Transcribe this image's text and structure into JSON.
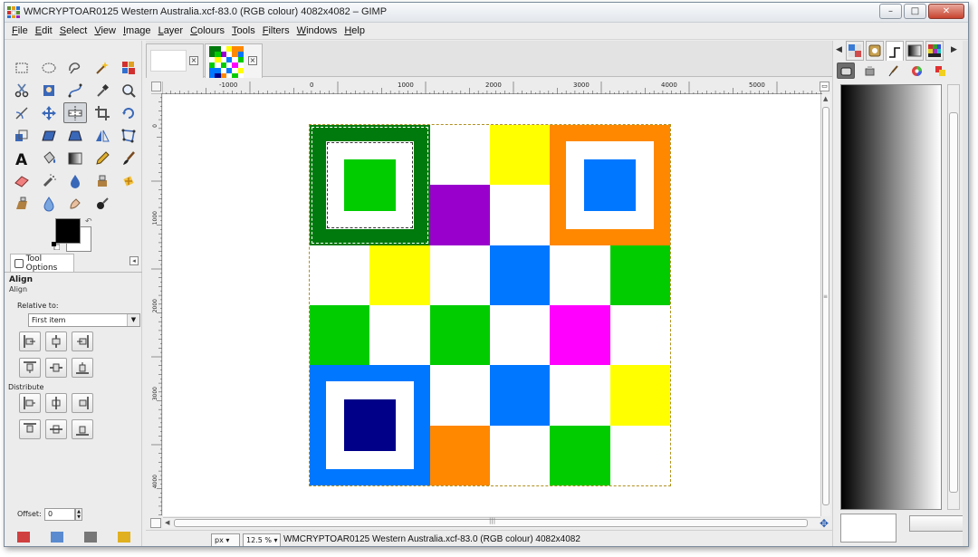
{
  "window": {
    "title": "WMCRYPTOAR0125 Western Australia.xcf-83.0 (RGB colour) 4082x4082 – GIMP",
    "minimize": "–",
    "maximize": "□",
    "close": "✕"
  },
  "menu": [
    "File",
    "Edit",
    "Select",
    "View",
    "Image",
    "Layer",
    "Colours",
    "Tools",
    "Filters",
    "Windows",
    "Help"
  ],
  "toolbox": {
    "tools": [
      "rect-select-icon",
      "ellipse-select-icon",
      "free-select-icon",
      "fuzzy-select-icon",
      "select-by-color-icon",
      "scissors-icon",
      "foreground-select-icon",
      "paths-icon",
      "color-picker-icon",
      "zoom-icon",
      "measure-icon",
      "move-icon",
      "align-icon",
      "crop-icon",
      "rotate-icon",
      "scale-icon",
      "shear-icon",
      "perspective-icon",
      "flip-icon",
      "cage-icon",
      "text-icon",
      "bucket-fill-icon",
      "blend-icon",
      "pencil-icon",
      "paintbrush-icon",
      "eraser-icon",
      "airbrush-icon",
      "ink-icon",
      "clone-icon",
      "heal-icon",
      "perspective-clone-icon",
      "blur-icon",
      "smudge-icon",
      "dodge-burn-icon"
    ],
    "active_tool": "align-icon",
    "foreground_color": "#000000",
    "background_color": "#ffffff"
  },
  "tool_options": {
    "tab_label": "Tool Options",
    "title": "Align",
    "subtitle": "Align",
    "relative_to_label": "Relative to:",
    "relative_to_value": "First item",
    "distribute_label": "Distribute",
    "offset_label": "Offset:",
    "offset_value": "0"
  },
  "rulers": {
    "h_labels": [
      "-1000",
      "0",
      "1000",
      "2000",
      "3000",
      "4000",
      "5000"
    ],
    "v_labels": [
      "0",
      "1000",
      "2000",
      "3000",
      "4000"
    ]
  },
  "image": {
    "colors": {
      "dark_green": "#007a0c",
      "green": "#00cc00",
      "white": "#ffffff",
      "yellow": "#ffff00",
      "purple": "#9900cc",
      "orange": "#ff8800",
      "blue": "#0077ff",
      "magenta": "#ff00ff",
      "navy": "#000088"
    },
    "grid": [
      [
        "F",
        "F",
        "white",
        "yellow",
        "F",
        "F"
      ],
      [
        "F",
        "F",
        "purple",
        "white",
        "F",
        "F"
      ],
      [
        "white",
        "yellow",
        "white",
        "blue",
        "white",
        "green"
      ],
      [
        "green",
        "white",
        "green",
        "white",
        "magenta",
        "white"
      ],
      [
        "F",
        "F",
        "white",
        "blue",
        "white",
        "yellow"
      ],
      [
        "F",
        "F",
        "orange",
        "white",
        "green",
        "white"
      ]
    ],
    "finders": [
      {
        "name": "finder-top-left",
        "outer": "dark_green",
        "inner": "green"
      },
      {
        "name": "finder-top-right",
        "outer": "orange",
        "inner": "blue"
      },
      {
        "name": "finder-bottom-left",
        "outer": "blue",
        "inner": "navy"
      }
    ]
  },
  "statusbar": {
    "unit": "px",
    "zoom": "12.5 %",
    "text": "WMCRYPTOAR0125 Western Australia.xcf-83.0 (RGB colour) 4082x4082"
  },
  "dock": {
    "top_tabs": [
      "patterns-icon",
      "brushes-icon",
      "paint-dynamics-icon",
      "gradient-icon",
      "palette-icon"
    ],
    "second_tabs": [
      "tool-options-icon",
      "device-status-icon",
      "paintbrush-icon",
      "color-wheel-icon",
      "colors-icon"
    ],
    "gradient": "FG to BG"
  }
}
